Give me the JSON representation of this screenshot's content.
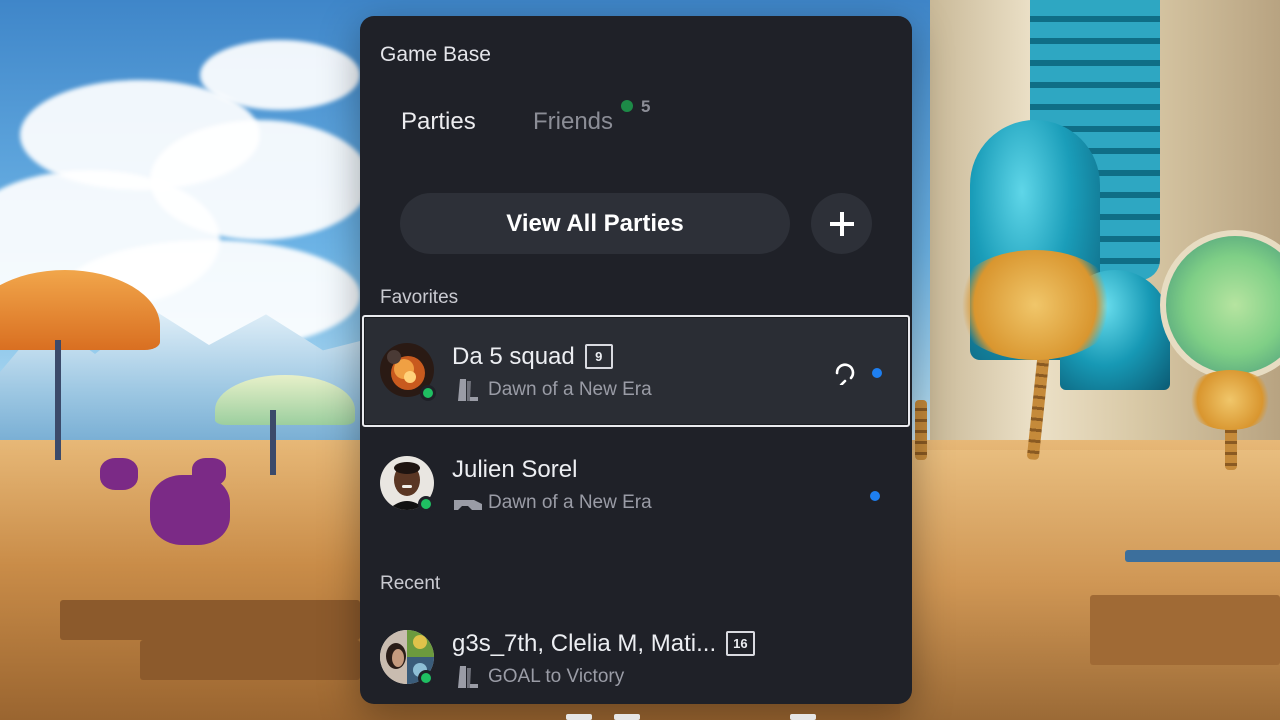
{
  "panel": {
    "title": "Game Base",
    "tabs": [
      {
        "label": "Parties",
        "active": true
      },
      {
        "label": "Friends",
        "active": false,
        "online_count": "5"
      }
    ],
    "view_all_label": "View All Parties",
    "add_icon": "plus-icon"
  },
  "favorites": {
    "label": "Favorites",
    "items": [
      {
        "name": "Da 5 squad",
        "member_count": "9",
        "game": "Dawn of a New Era",
        "platform_icon": "ps5-console-icon",
        "voice_icon": "headset-icon",
        "online": true,
        "selected": true
      },
      {
        "name": "Julien Sorel",
        "game": "Dawn of a New Era",
        "platform_icon": "ps-vr2-icon",
        "online": true,
        "selected": false
      }
    ]
  },
  "recent": {
    "label": "Recent",
    "items": [
      {
        "name": "g3s_7th, Clelia M, Mati...",
        "member_count": "16",
        "game": "GOAL to Victory",
        "platform_icon": "ps5-console-icon",
        "online": true
      }
    ]
  },
  "colors": {
    "panel_bg": "#1f2128",
    "button_bg": "#2d3038",
    "online_green": "#1fbf62",
    "unread_blue": "#1e7ff0",
    "selection_border": "#e9eaee"
  }
}
